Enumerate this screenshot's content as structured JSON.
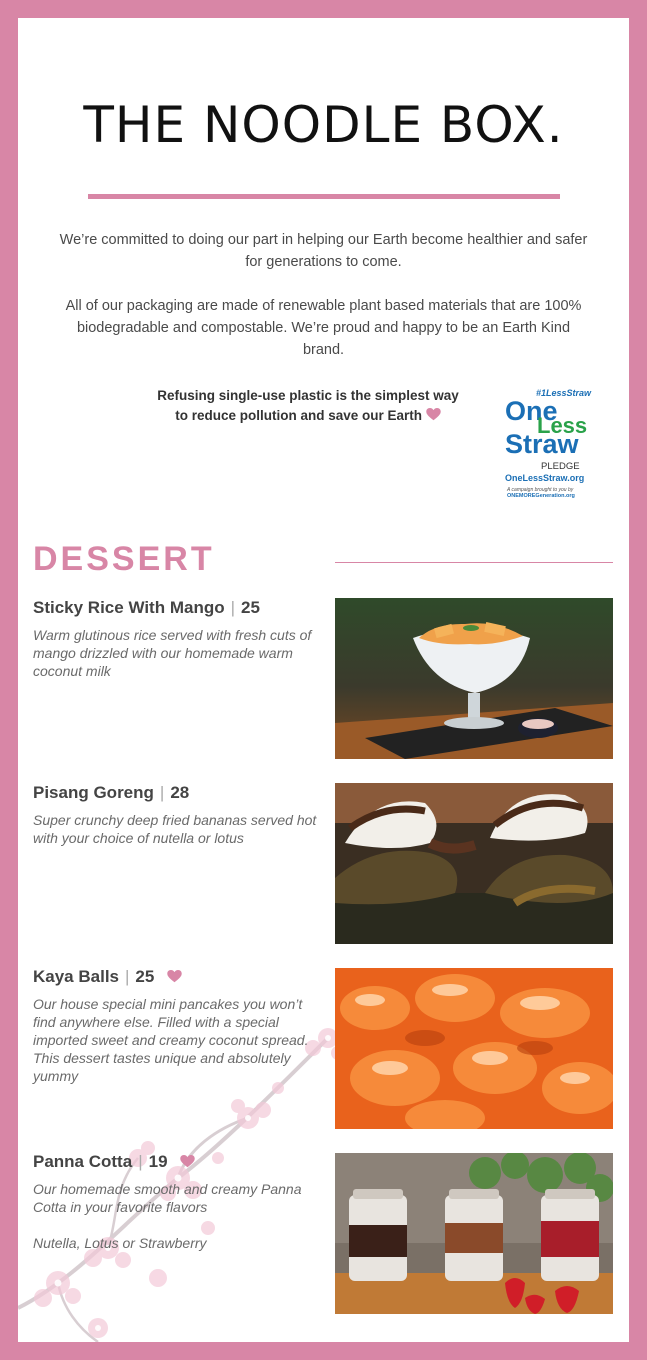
{
  "brand": {
    "name": "THE NOODLE BOX."
  },
  "intro": {
    "paragraph1": "We’re committed to doing our part in helping our Earth become healthier and safer for generations to come.",
    "paragraph2": "All of our packaging are made of renewable plant based materials that are 100% biodegradable and compostable. We’re proud and happy to be an Earth Kind brand."
  },
  "pledge": {
    "line1": "Refusing single-use plastic is the simplest way",
    "line2": "to reduce pollution and save our Earth",
    "logo": {
      "hashtag": "#1LessStraw",
      "word1": "One",
      "word2": "Less",
      "word3": "Straw",
      "pledge_label": "PLEDGE",
      "url": "OneLessStraw.org",
      "campaign": "A campaign brought to you by",
      "org": "ONEMOREGeneration.org"
    }
  },
  "section": {
    "title": "DESSERT"
  },
  "items": [
    {
      "name": "Sticky Rice With Mango",
      "price": "25",
      "favorite": false,
      "description": "Warm glutinous rice served with fresh cuts of mango drizzled with our homemade warm coconut milk",
      "note": ""
    },
    {
      "name": "Pisang Goreng",
      "price": "28",
      "favorite": false,
      "description": "Super crunchy deep fried bananas served hot with your choice of nutella or lotus",
      "note": ""
    },
    {
      "name": "Kaya Balls",
      "price": "25",
      "favorite": true,
      "description": "Our house special mini pancakes you won’t find anywhere else. Filled with a special imported sweet and creamy coconut spread. This dessert tastes unique and absolutely yummy",
      "note": ""
    },
    {
      "name": "Panna Cotta",
      "price": "19",
      "favorite": true,
      "description": "Our homemade smooth and creamy Panna Cotta in your favorite flavors",
      "note": "Nutella, Lotus or Strawberry"
    }
  ],
  "colors": {
    "accent": "#d886a6",
    "text": "#444444",
    "logo_blue": "#1b6fb5",
    "logo_green": "#2aa24a"
  }
}
